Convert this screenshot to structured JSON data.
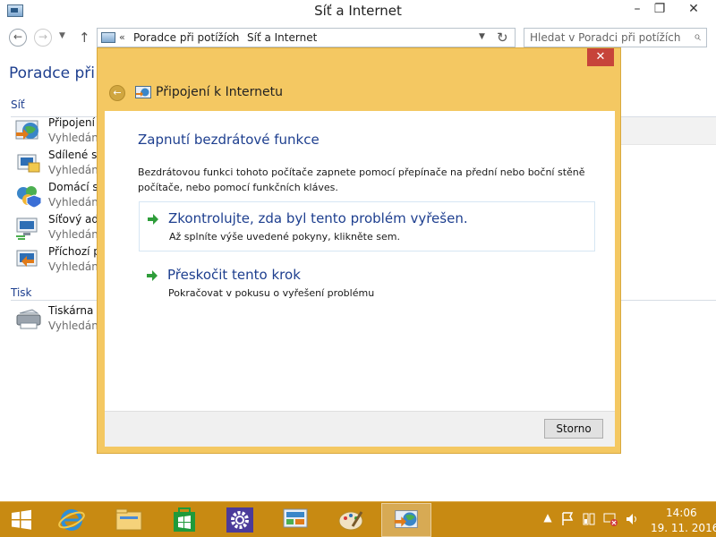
{
  "window": {
    "title": "Síť a Internet",
    "minimize": "–",
    "maximize": "❐",
    "close": "✕"
  },
  "navigation": {
    "back": "←",
    "forward": "→",
    "recent": "▼",
    "up": "↑",
    "address_chevron": "«",
    "breadcrumb": [
      "Poradce při potížích",
      "Síť a Internet"
    ],
    "breadcrumb_separator": "›",
    "address_dropdown": "▼",
    "refresh": "↻",
    "search_placeholder": "Hledat v Poradci při potížích",
    "search_icon": "⌕"
  },
  "main": {
    "heading": "Poradce při po",
    "groups": [
      {
        "header": "Síť",
        "items": [
          {
            "name": "Připojení k",
            "desc": "Vyhledání",
            "icon": "internet-globe-icon"
          },
          {
            "name": "Sdílené slo",
            "desc": "Vyhledání",
            "icon": "shared-folders-icon"
          },
          {
            "name": "Domácí sk",
            "desc": "Vyhledání",
            "icon": "homegroup-icon"
          },
          {
            "name": "Síťový ada",
            "desc": "Vyhledání",
            "icon": "network-adapter-icon"
          },
          {
            "name": "Příchozí př",
            "desc": "Vyhledání",
            "icon": "incoming-connections-icon"
          }
        ]
      },
      {
        "header": "Tisk",
        "items": [
          {
            "name": "Tiskárna",
            "desc": "Vyhledání",
            "icon": "printer-icon"
          }
        ]
      }
    ]
  },
  "dialog": {
    "title": "Připojení k Internetu",
    "close": "✕",
    "back": "←",
    "heading": "Zapnutí bezdrátové funkce",
    "instructions": "Bezdrátovou funkci tohoto počítače zapnete pomocí přepínače na přední nebo boční stěně počítače, nebo pomocí funkčních kláves.",
    "options": [
      {
        "title": "Zkontrolujte, zda byl tento problém vyřešen.",
        "subtitle": "Až splníte výše uvedené pokyny, klikněte sem."
      },
      {
        "title": "Přeskočit tento krok",
        "subtitle": "Pokračovat v pokusu o vyřešení problému"
      }
    ],
    "cancel": "Storno"
  },
  "taskbar": {
    "apps": [
      "internet-explorer-icon",
      "file-explorer-icon",
      "store-icon",
      "settings-gear-icon",
      "control-panel-icon",
      "paint-icon",
      "troubleshooter-icon"
    ],
    "tray_icons": [
      "show-hidden-icons-icon",
      "action-center-flag-icon",
      "power-icon",
      "network-disconnected-icon",
      "volume-icon"
    ],
    "tray_glyphs": {
      "show_hidden": "▲"
    },
    "time": "14:06",
    "date": "19. 11. 2016"
  },
  "colors": {
    "dialog_frame": "#f4c862",
    "taskbar": "#c88a12",
    "link_blue": "#1e3f8f",
    "close_red": "#c7443a"
  }
}
